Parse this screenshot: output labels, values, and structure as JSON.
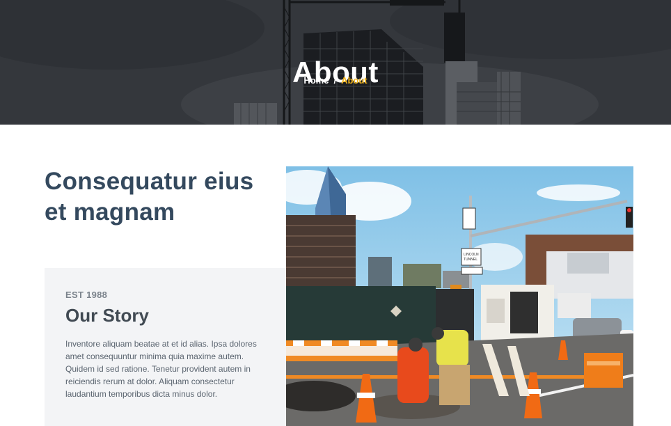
{
  "hero": {
    "title": "About",
    "breadcrumb": {
      "home": "Home",
      "separator": "/",
      "current": "About"
    }
  },
  "intro": {
    "headline": "Consequatur eius et magnam"
  },
  "story": {
    "eyebrow": "EST 1988",
    "title": "Our Story",
    "body": "Inventore aliquam beatae at et id alias. Ipsa dolores amet consequuntur minima quia maxime autem. Quidem id sed ratione. Tenetur provident autem in reiciendis rerum at dolor. Aliquam consectetur laudantium temporibus dicta minus dolor."
  },
  "photo": {
    "sign_text": "LINCOLN TUNNEL 3 LEFT LANES"
  },
  "colors": {
    "accent": "#f2b51c",
    "heading": "#34495e",
    "card_bg": "#f3f4f6"
  }
}
